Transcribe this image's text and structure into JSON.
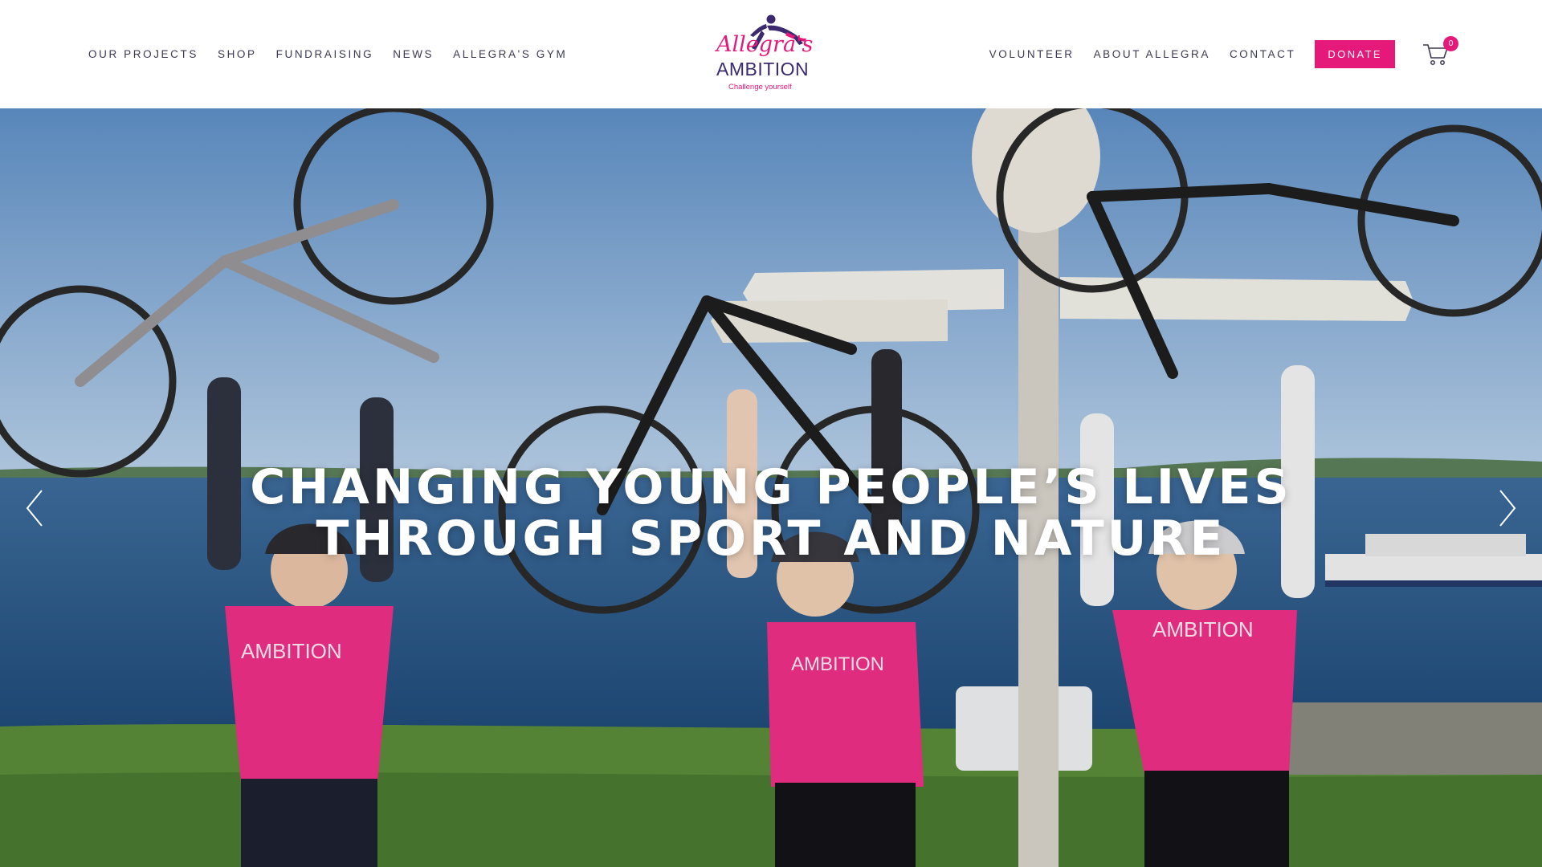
{
  "nav_left": [
    "OUR PROJECTS",
    "SHOP",
    "FUNDRAISING",
    "NEWS",
    "ALLEGRA'S GYM"
  ],
  "nav_right": [
    "VOLUNTEER",
    "ABOUT ALLEGRA",
    "CONTACT"
  ],
  "donate_label": "DONATE",
  "cart_count": "0",
  "logo": {
    "script_text": "Allegra's",
    "name_text": "AMBITION",
    "tagline": "Challenge yourself"
  },
  "hero": {
    "headline_line1": "CHANGING YOUNG PEOPLE’S LIVES",
    "headline_line2": "THROUGH SPORT AND NATURE"
  },
  "icons": {
    "cart": "shopping-cart-icon",
    "prev": "chevron-left-icon",
    "next": "chevron-right-icon",
    "logo_figure": "hurdler-figure-icon"
  },
  "colors": {
    "accent_pink": "#e5197a",
    "nav_text": "#3c3a52",
    "logo_purple": "#3b2a6e"
  }
}
